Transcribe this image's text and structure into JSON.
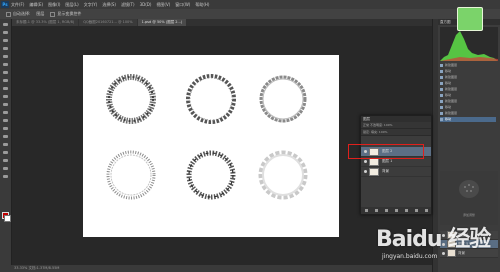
{
  "menubar": {
    "logo": "Ps",
    "items": [
      "文件(F)",
      "编辑(E)",
      "图像(I)",
      "图层(L)",
      "文字(Y)",
      "选择(S)",
      "滤镜(T)",
      "3D(D)",
      "视图(V)",
      "窗口(W)",
      "帮助(H)"
    ]
  },
  "options": {
    "items": [
      "自动选择:",
      "图层",
      "显示变换控件"
    ]
  },
  "tabs": [
    {
      "label": "未标题-1 @ 33.3% (图层 1, RGB/8)"
    },
    {
      "label": "QQ截图20160721... @ 100%"
    },
    {
      "label": "1.psd @ 50% (图层 2...)"
    }
  ],
  "statusbar": {
    "text": "33.33%  文档:1.37M/8.55M"
  },
  "right_panel": {
    "histogram_title": "直方图",
    "history_rows": [
      "新建图层",
      "移动",
      "新建图层",
      "移动",
      "新建图层",
      "移动",
      "新建图层",
      "移动",
      "新建图层",
      "移动"
    ],
    "adjust_label": "添加调整",
    "layer_rows": [
      "图层 6",
      "图层 5",
      "背景"
    ]
  },
  "layers_panel": {
    "title": "图层",
    "controls": "正常  不透明度: 100%",
    "lock": "锁定:  填充: 100%",
    "rows": [
      "图层 2",
      "图层 1",
      "背景"
    ]
  },
  "watermark": {
    "brand": "Baidu 经验",
    "url": "jingyan.baidu.com"
  },
  "colors": {
    "foreground": "#c00000",
    "background": "#ffffff",
    "highlight": "#e0201c"
  }
}
